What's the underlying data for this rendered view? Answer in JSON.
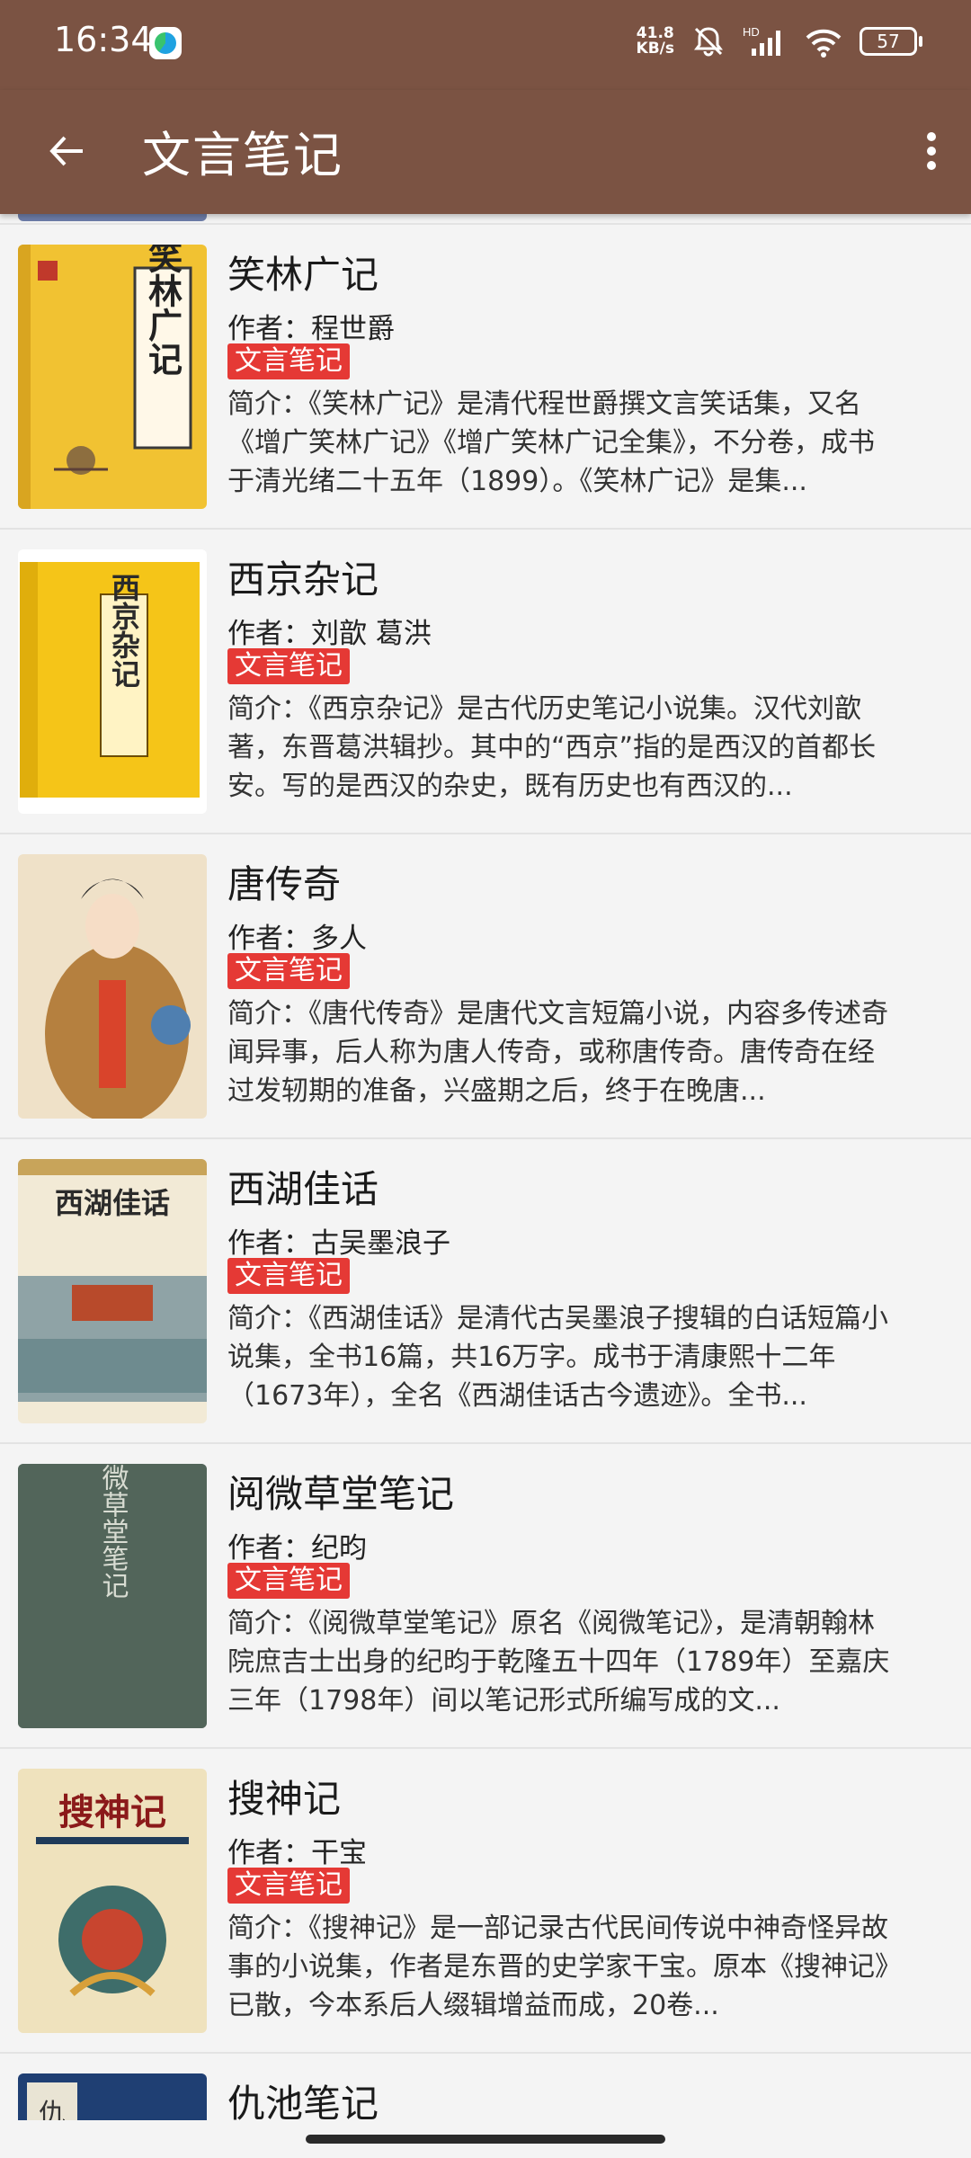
{
  "status_bar": {
    "time": "16:34",
    "net_speed_value": "41.8",
    "net_speed_unit": "KB/s",
    "signal_label": "HD",
    "battery": "57"
  },
  "app_bar": {
    "title": "文言笔记"
  },
  "books": [
    {
      "title": "笑林广记",
      "author": "作者：程世爵",
      "tag": "文言笔记",
      "intro": "简介：《笑林广记》是清代程世爵撰文言笑话集，又名《增广笑林广记》《增广笑林广记全集》，不分卷，成书于清光绪二十五年（1899）。《笑林广记》是集...",
      "cover_text": "笑林广记"
    },
    {
      "title": "西京杂记",
      "author": "作者：刘歆 葛洪",
      "tag": "文言笔记",
      "intro": "简介：《西京杂记》是古代历史笔记小说集。汉代刘歆著，东晋葛洪辑抄。其中的“西京”指的是西汉的首都长安。写的是西汉的杂史，既有历史也有西汉的...",
      "cover_text": "西京杂记"
    },
    {
      "title": "唐传奇",
      "author": "作者：多人",
      "tag": "文言笔记",
      "intro": "简介：《唐代传奇》是唐代文言短篇小说，内容多传述奇闻异事，后人称为唐人传奇，或称唐传奇。唐传奇在经过发轫期的准备，兴盛期之后，终于在晚唐...",
      "cover_text": ""
    },
    {
      "title": "西湖佳话",
      "author": "作者：古吴墨浪子",
      "tag": "文言笔记",
      "intro": "简介：《西湖佳话》是清代古吴墨浪子搜辑的白话短篇小说集，全书16篇，共16万字。成书于清康熙十二年（1673年），全名《西湖佳话古今遗迹》。全书...",
      "cover_text": "西湖佳话"
    },
    {
      "title": "阅微草堂笔记",
      "author": "作者：纪昀",
      "tag": "文言笔记",
      "intro": "简介：《阅微草堂笔记》原名《阅微笔记》，是清朝翰林院庶吉士出身的纪昀于乾隆五十四年（1789年）至嘉庆三年（1798年）间以笔记形式所编写成的文...",
      "cover_text": "阅微草堂笔记"
    },
    {
      "title": "搜神记",
      "author": "作者：干宝",
      "tag": "文言笔记",
      "intro": "简介：《搜神记》是一部记录古代民间传说中神奇怪异故事的小说集，作者是东晋的史学家干宝。原本《搜神记》已散，今本系后人缀辑增益而成，20卷...",
      "cover_text": "搜神记"
    }
  ],
  "partial_book": {
    "title": "仇池笔记",
    "cover_text": "仇"
  },
  "colors": {
    "app_bar": "#7b5343",
    "tag": "#e53935",
    "background": "#f4f4f4"
  }
}
